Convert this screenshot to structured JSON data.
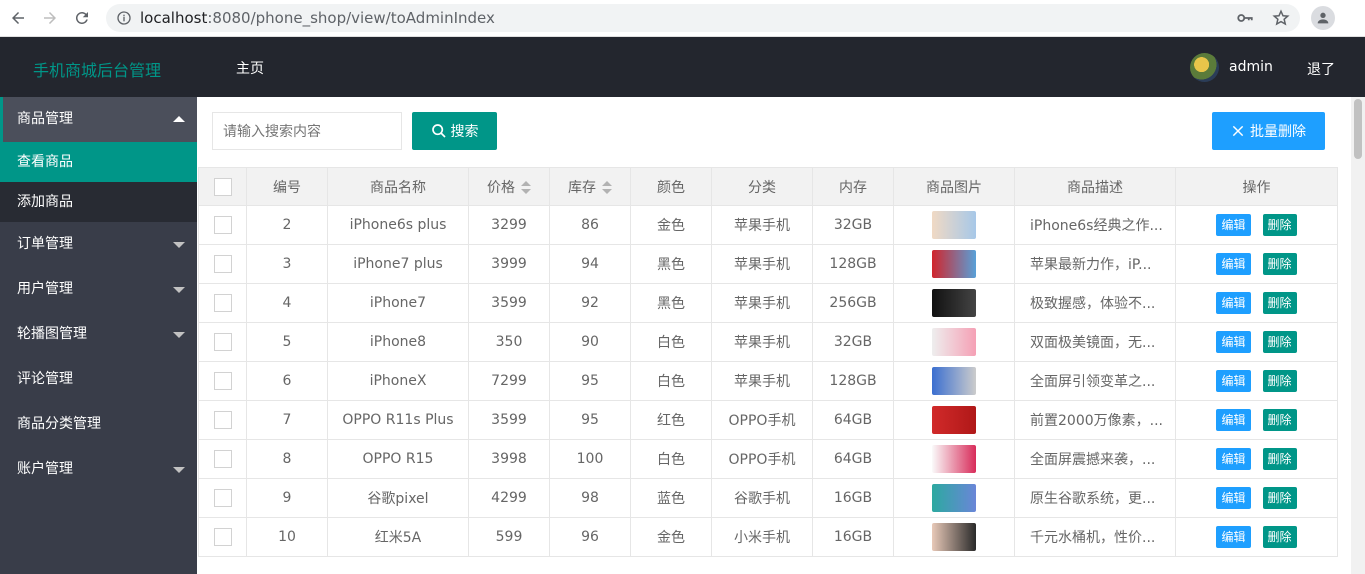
{
  "browser": {
    "url_host": "localhost",
    "url_path": ":8080/phone_shop/view/toAdminIndex"
  },
  "header": {
    "brand": "手机商城后台管理",
    "home": "主页",
    "user": "admin",
    "logout": "退了"
  },
  "sidebar": {
    "groups": [
      {
        "label": "商品管理",
        "open": true,
        "items": [
          {
            "label": "查看商品",
            "active": true
          },
          {
            "label": "添加商品",
            "active": false
          }
        ]
      },
      {
        "label": "订单管理",
        "open": false
      },
      {
        "label": "用户管理",
        "open": false
      },
      {
        "label": "轮播图管理",
        "open": false
      },
      {
        "label": "评论管理"
      },
      {
        "label": "商品分类管理"
      },
      {
        "label": "账户管理",
        "open": false
      }
    ]
  },
  "toolbar": {
    "search_placeholder": "请输入搜索内容",
    "search_label": "搜索",
    "batch_delete_label": "批量删除"
  },
  "table": {
    "headers": [
      "编号",
      "商品名称",
      "价格",
      "库存",
      "颜色",
      "分类",
      "内存",
      "商品图片",
      "商品描述",
      "操作"
    ],
    "edit_label": "编辑",
    "delete_label": "删除",
    "rows": [
      {
        "id": "2",
        "name": "iPhone6s plus",
        "price": "3299",
        "stock": "86",
        "color": "金色",
        "category": "苹果手机",
        "memory": "32GB",
        "desc": "iPhone6s经典之作..."
      },
      {
        "id": "3",
        "name": "iPhone7 plus",
        "price": "3999",
        "stock": "94",
        "color": "黑色",
        "category": "苹果手机",
        "memory": "128GB",
        "desc": "苹果最新力作，iP..."
      },
      {
        "id": "4",
        "name": "iPhone7",
        "price": "3599",
        "stock": "92",
        "color": "黑色",
        "category": "苹果手机",
        "memory": "256GB",
        "desc": "极致握感，体验不..."
      },
      {
        "id": "5",
        "name": "iPhone8",
        "price": "350",
        "stock": "90",
        "color": "白色",
        "category": "苹果手机",
        "memory": "32GB",
        "desc": "双面极美镜面，无..."
      },
      {
        "id": "6",
        "name": "iPhoneX",
        "price": "7299",
        "stock": "95",
        "color": "白色",
        "category": "苹果手机",
        "memory": "128GB",
        "desc": "全面屏引领变革之..."
      },
      {
        "id": "7",
        "name": "OPPO R11s Plus",
        "price": "3599",
        "stock": "95",
        "color": "红色",
        "category": "OPPO手机",
        "memory": "64GB",
        "desc": "前置2000万像素，..."
      },
      {
        "id": "8",
        "name": "OPPO R15",
        "price": "3998",
        "stock": "100",
        "color": "白色",
        "category": "OPPO手机",
        "memory": "64GB",
        "desc": "全面屏震撼来袭，..."
      },
      {
        "id": "9",
        "name": "谷歌pixel",
        "price": "4299",
        "stock": "98",
        "color": "蓝色",
        "category": "谷歌手机",
        "memory": "16GB",
        "desc": "原生谷歌系统，更..."
      },
      {
        "id": "10",
        "name": "红米5A",
        "price": "599",
        "stock": "96",
        "color": "金色",
        "category": "小米手机",
        "memory": "16GB",
        "desc": "千元水桶机，性价..."
      }
    ]
  }
}
